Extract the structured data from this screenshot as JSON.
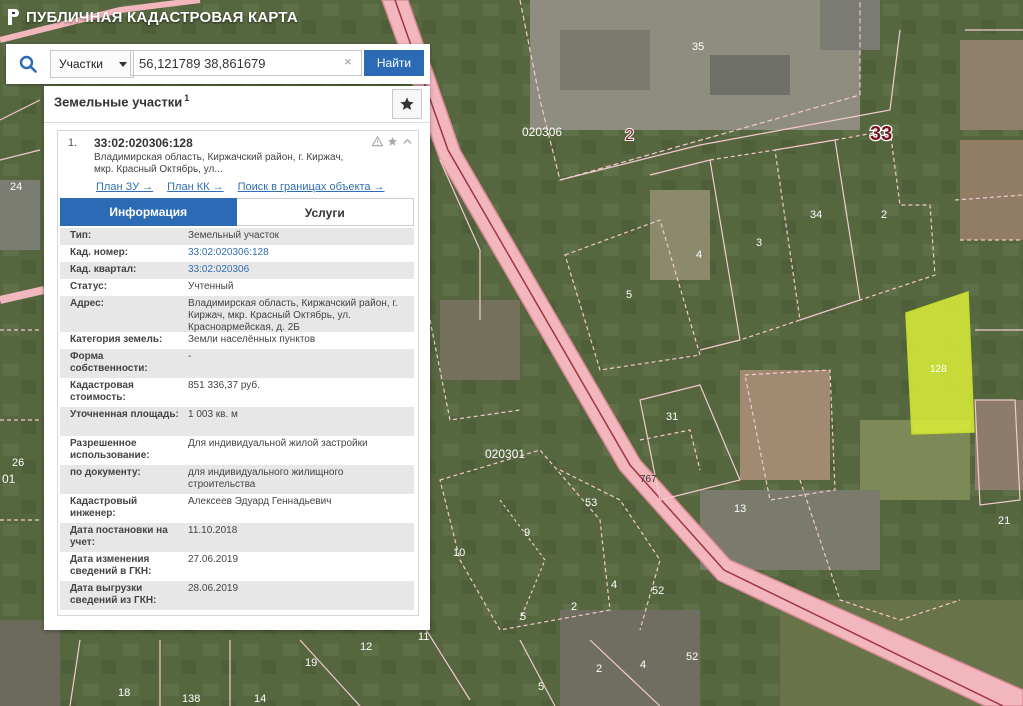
{
  "app": {
    "title": "ПУБЛИЧНАЯ КАДАСТРОВАЯ КАРТА"
  },
  "search": {
    "type_label": "Участки",
    "query": "56,121789 38,861679",
    "clear_symbol": "×",
    "find_label": "Найти"
  },
  "panel": {
    "title": "Земельные участки",
    "title_sup": "1"
  },
  "result": {
    "index": "1.",
    "cad_number": "33:02:020306:128",
    "address_short": "Владимирская область, Киржачский район, г. Киржач, мкр. Красный Октябрь, ул...",
    "links": [
      "План ЗУ →",
      "План КК →",
      "Поиск в границах объекта →"
    ]
  },
  "tabs": {
    "info": "Информация",
    "services": "Услуги"
  },
  "info_rows": [
    {
      "label": "Тип:",
      "value": "Земельный участок"
    },
    {
      "label": "Кад. номер:",
      "value": "33:02:020306:128"
    },
    {
      "label": "Кад. квартал:",
      "value": "33:02:020306"
    },
    {
      "label": "Статус:",
      "value": "Учтенный"
    },
    {
      "label": "Адрес:",
      "value": "Владимирская область, Киржачский район, г. Киржач, мкр. Красный Октябрь, ул. Красноармейская, д. 2Б"
    },
    {
      "label": "Категория земель:",
      "value": "Земли населённых пунктов"
    },
    {
      "label": "Форма собственности:",
      "value": "-"
    },
    {
      "label": "Кадастровая стоимость:",
      "value": "851 336,37 руб."
    },
    {
      "label": "Уточненная площадь:",
      "value": "1 003 кв. м"
    },
    {
      "label": "Разрешенное использование:",
      "value": "Для индивидуальной жилой застройки"
    },
    {
      "label": "по документу:",
      "value": "для индивидуального жилищного строительства"
    },
    {
      "label": "Кадастровый инженер:",
      "value": "Алексеев Эдуард Геннадьевич"
    },
    {
      "label": "Дата постановки на учет:",
      "value": "11.10.2018"
    },
    {
      "label": "Дата изменения сведений в ГКН:",
      "value": "27.06.2019"
    },
    {
      "label": "Дата выгрузки сведений из ГКН:",
      "value": "28.06.2019"
    }
  ],
  "map_labels": {
    "district": "33",
    "q020306": "020306",
    "q020301": "020301",
    "n2": "2",
    "n35": "35",
    "n24": "24",
    "n4": "4",
    "n3": "3",
    "n34": "34",
    "n2b": "2",
    "n5": "5",
    "n128": "128",
    "n31": "31",
    "n767": "767",
    "n13": "13",
    "n21": "21",
    "n26": "26",
    "n01": "01",
    "n53": "53",
    "n9": "9",
    "n10": "10",
    "n4c": "4",
    "n52": "52",
    "n2c": "2",
    "n5c": "5",
    "n52b": "52",
    "n4d": "4",
    "n2d": "2",
    "n12": "12",
    "n19": "19",
    "n18": "18",
    "n138": "138",
    "n14": "14",
    "n11": "11",
    "n5d": "5"
  },
  "colors": {
    "brand": "#2b6bb5",
    "road": "#f2b6bd",
    "parcel_selected": "#d9ee3a"
  }
}
